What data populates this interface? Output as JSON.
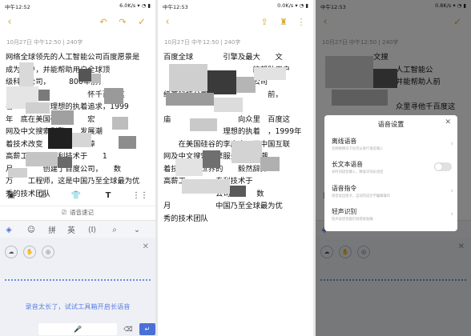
{
  "colors": {
    "accent": "#d8a838",
    "voice_blue": "#5a7fe0",
    "keyboard_bg": "#eef0f5"
  },
  "screens": [
    {
      "status": {
        "time": "中午12:52",
        "net": "6.0K/s"
      },
      "date": "10月27日  中午12:50  |  240字",
      "lines": [
        "网络全球领先的人工智能公司百度愿景是",
        "成为用户，并能帮助用户全球顶",
        "级科技公司，　　　800年前，",
        "　　　　　　　　　　　怀千百度这",
        "名　　　入对理想的执着追求，1999",
        "年　底在美国硅谷　　　宏",
        "网及中文搜索引擎　　发展潮",
        "着技术改变　　　　然辞掉",
        "高薪工作，携专利技术于　　1",
        "月　　　　创建了百度公司，　　数",
        "万　　工程师，这是中国乃至全球最为优",
        "秀的技术团队"
      ],
      "voice_tag": "语音速记",
      "kb_tip": "录音太长了，试试工具箱开启长语音",
      "ime_pinyin": "拼",
      "ime_english": "英"
    },
    {
      "status": {
        "time": "中午12:53",
        "net": "0.0K/s"
      },
      "date": "10月27日  中午12:50  |  240字",
      "lines": [
        "百度全球　　　　引擎及最大　　文",
        "　　　　　　　　　　　　能帮助用户",
        "　　为最懂用户，人工智能公司　　",
        "级高科技公司　　　　　　　　前，",
        "　　　　　　　　　　　　　　　　",
        "庙　　　　　　　　　向众里　百度这",
        "　　　　　　　　理想的执着　，1999年",
        "　　在美国硅谷的李彦宏　了中国互联",
        "网及中文搜索引擎服务　发展潮",
        "着技术改变世界的　　毅然辞掉",
        "高薪工　　　　专利技术于",
        "　　　　　　　公司，　　　数",
        "月　　　　　　中国乃至全球最为优",
        "秀的技术团队"
      ]
    },
    {
      "status": {
        "time": "中午12:53",
        "net": "0.8K/s"
      },
      "date": "10月27日  中午12:50  |  240字",
      "lines": [
        "　　　　　　　文搜　　　　　　　",
        "　　　　　　　　　　人工智能公",
        "　　　　　　　　　　并能帮助人前",
        "　　　　　　　　　　　　　　　　",
        "　　　　　　　　　　众里寻他千百度这",
        "　　　　　　　　　　　　　　　　",
        "　　　　　　　　　　　　　　　　"
      ],
      "dialog": {
        "title": "语音设置",
        "options": [
          {
            "title": "离线语音",
            "desc": "无网络情况下也可以进行语音输入"
          },
          {
            "title": "长文本语音",
            "desc": "长时间语音输入，精准识别长语音"
          },
          {
            "title": "语音指令",
            "desc": "语音说出指令，自动完成文字编辑操作"
          },
          {
            "title": "轻声识别",
            "desc": "轻声说话也能识别得很准确"
          }
        ]
      }
    }
  ]
}
